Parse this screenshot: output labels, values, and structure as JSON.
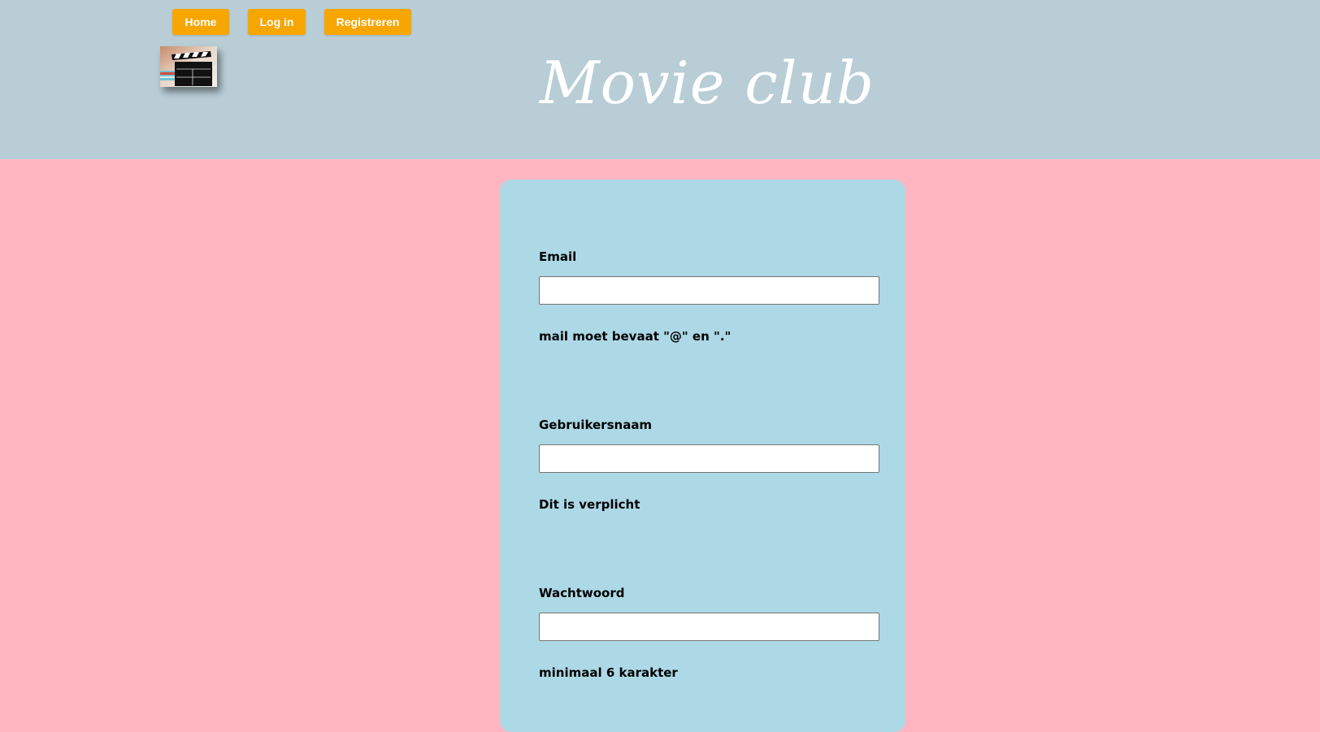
{
  "nav": {
    "home_label": "Home",
    "login_label": "Log in",
    "register_label": "Registreren"
  },
  "header": {
    "title": "Movie club",
    "logo_icon": "clapperboard-icon"
  },
  "form": {
    "email": {
      "label": "Email",
      "value": "",
      "hint": "mail moet bevaat \"@\" en \".\""
    },
    "username": {
      "label": "Gebruikersnaam",
      "value": "",
      "hint": "Dit is verplicht"
    },
    "password": {
      "label": "Wachtwoord",
      "value": "",
      "hint": "minimaal 6 karakter"
    }
  },
  "colors": {
    "header_bg": "#b8cdd6",
    "page_bg": "#ffb6c1",
    "panel_bg": "#add8e6",
    "button_bg": "#f7a600"
  }
}
